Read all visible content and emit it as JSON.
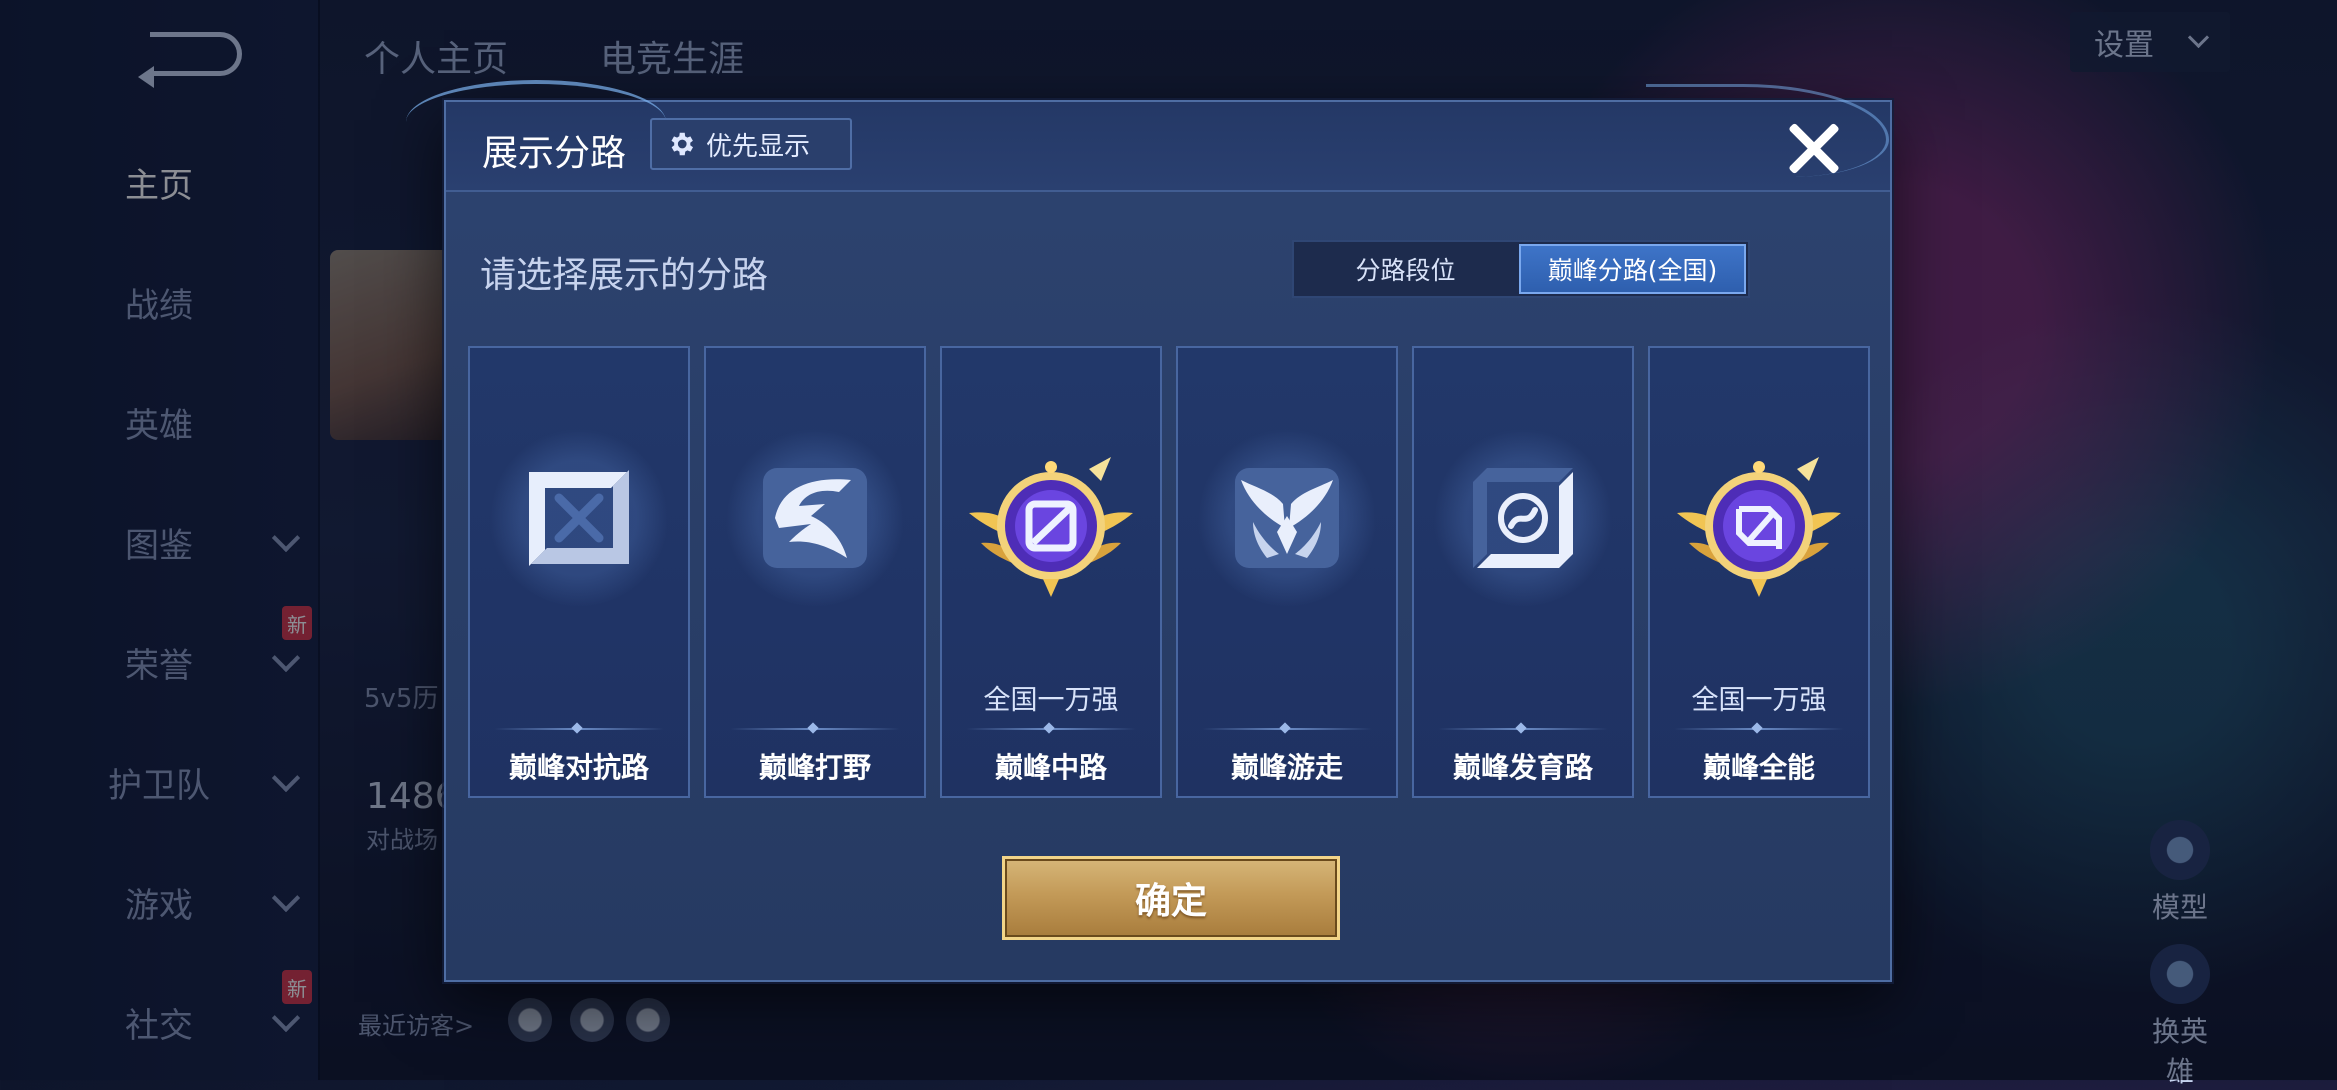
{
  "sidebar": {
    "items": [
      {
        "label": "主页",
        "active": true
      },
      {
        "label": "战绩"
      },
      {
        "label": "英雄"
      },
      {
        "label": "图鉴",
        "dropdown": true
      },
      {
        "label": "荣誉",
        "dropdown": true,
        "badge": "新"
      },
      {
        "label": "护卫队",
        "dropdown": true
      },
      {
        "label": "游戏",
        "dropdown": true
      },
      {
        "label": "社交",
        "dropdown": true,
        "badge": "新"
      }
    ]
  },
  "header": {
    "tabs": [
      "个人主页",
      "电竞生涯"
    ],
    "settings_label": "设置"
  },
  "background": {
    "mode_text": "5v5历",
    "score_text": "1486",
    "score_sub": "对战场",
    "recent_visitors": "最近访客>",
    "model_label": "模型",
    "switch_hero_label": "换英雄"
  },
  "modal": {
    "title": "展示分路",
    "priority_label": "优先显示",
    "prompt": "请选择展示的分路",
    "tabs": [
      {
        "label": "分路段位",
        "active": false
      },
      {
        "label": "巅峰分路(全国)",
        "active": true
      }
    ],
    "lanes": [
      {
        "name": "巅峰对抗路",
        "icon": "clash-lane-icon",
        "rank": ""
      },
      {
        "name": "巅峰打野",
        "icon": "jungle-dragon-icon",
        "rank": ""
      },
      {
        "name": "巅峰中路",
        "icon": "mid-lane-medal-icon",
        "rank": "全国一万强"
      },
      {
        "name": "巅峰游走",
        "icon": "roam-wings-icon",
        "rank": ""
      },
      {
        "name": "巅峰发育路",
        "icon": "farm-lane-icon",
        "rank": ""
      },
      {
        "name": "巅峰全能",
        "icon": "all-round-medal-icon",
        "rank": "全国一万强"
      }
    ],
    "confirm_label": "确定"
  },
  "colors": {
    "modal_bg": "#2a3f69",
    "active_tab": "#3e74c8",
    "confirm_gold": "#c39a58",
    "medal_purple": "#5b2fc4",
    "medal_gold": "#f1c453"
  }
}
